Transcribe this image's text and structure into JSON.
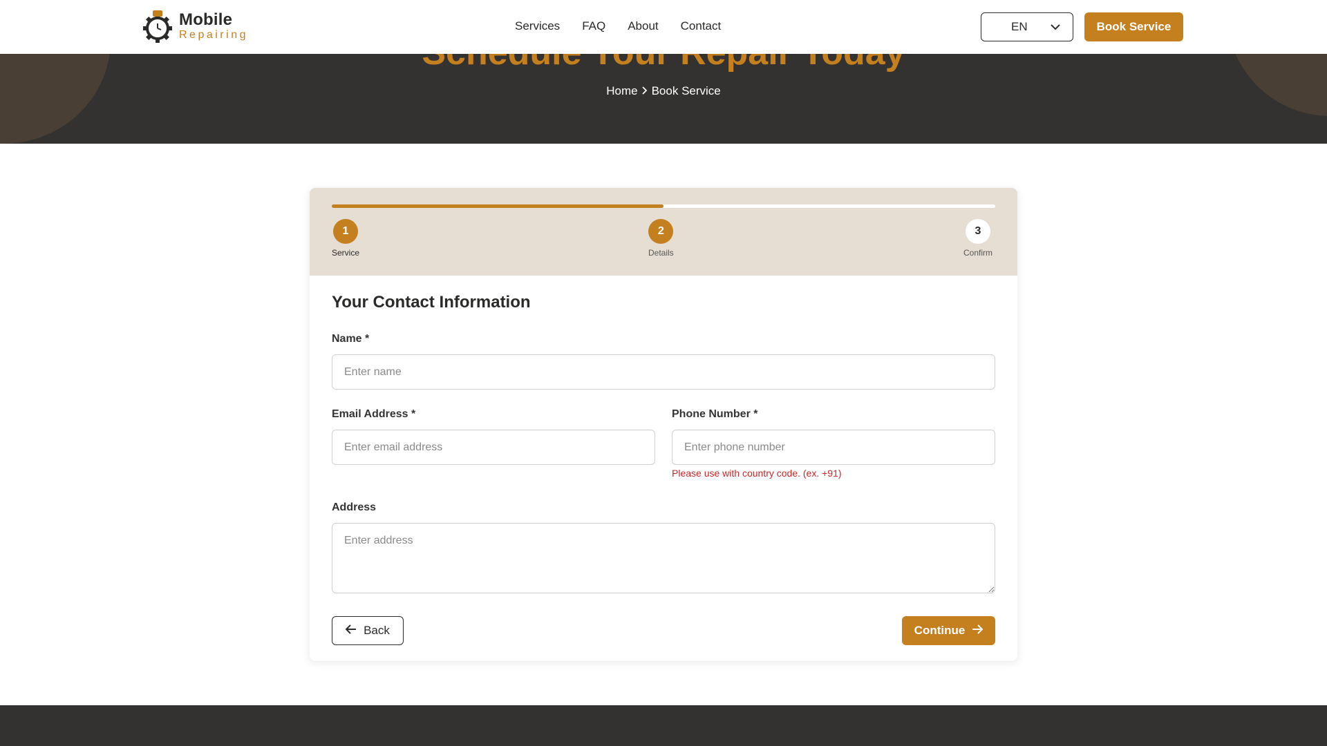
{
  "header": {
    "logo": {
      "title": "Mobile",
      "subtitle": "Repairing",
      "icon": "gear-phone-logo-icon"
    },
    "nav": [
      "Services",
      "FAQ",
      "About",
      "Contact"
    ],
    "language": {
      "selected": "EN",
      "icon": "chevron-down-icon"
    },
    "book_button": "Book Service"
  },
  "hero": {
    "title": "Schedule Your Repair Today",
    "breadcrumb": {
      "home": "Home",
      "current": "Book Service",
      "separator_icon": "chevron-right-icon"
    }
  },
  "stepper": {
    "progress_fraction": 0.5,
    "steps": [
      {
        "number": "1",
        "label": "Service",
        "state": "done"
      },
      {
        "number": "2",
        "label": "Details",
        "state": "done"
      },
      {
        "number": "3",
        "label": "Confirm",
        "state": "todo"
      }
    ]
  },
  "form": {
    "title": "Your Contact Information",
    "name": {
      "label": "Name *",
      "placeholder": "Enter name",
      "value": ""
    },
    "email": {
      "label": "Email Address *",
      "placeholder": "Enter email address",
      "value": ""
    },
    "phone": {
      "label": "Phone Number *",
      "placeholder": "Enter phone number",
      "value": "",
      "hint": "Please use with country code. (ex. +91)"
    },
    "address": {
      "label": "Address",
      "placeholder": "Enter address",
      "value": ""
    },
    "back_button": {
      "label": "Back",
      "icon": "arrow-left-icon"
    },
    "continue_button": {
      "label": "Continue",
      "icon": "arrow-right-icon"
    }
  },
  "colors": {
    "accent": "#c47f1e",
    "dark": "#333230",
    "stepper_bg": "#e6ddd3",
    "error": "#c62828"
  }
}
